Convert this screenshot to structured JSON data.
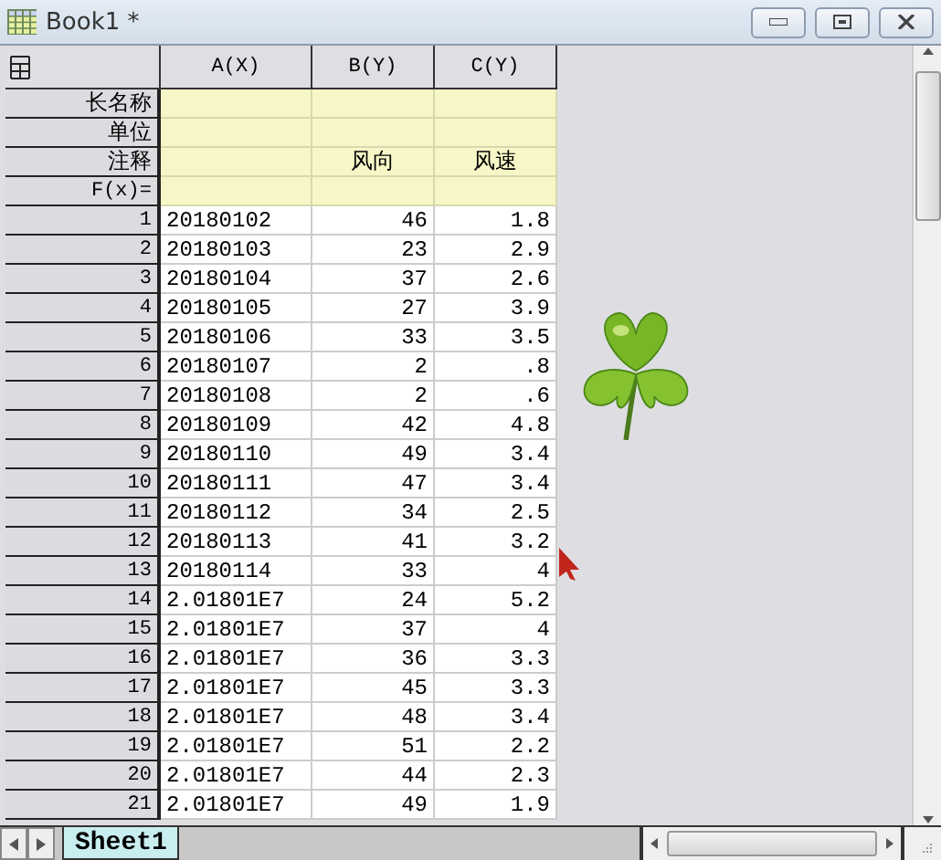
{
  "window": {
    "title": "Book1 *"
  },
  "columns": [
    {
      "label": "A(X)"
    },
    {
      "label": "B(Y)"
    },
    {
      "label": "C(Y)"
    }
  ],
  "label_rows": [
    {
      "label": "长名称",
      "cells": {}
    },
    {
      "label": "单位",
      "cells": {}
    },
    {
      "label": "注释",
      "cells": {
        "b": "风向",
        "c": "风速"
      }
    },
    {
      "label": "F(x)=",
      "cells": {}
    }
  ],
  "rows": [
    {
      "number": "1",
      "cells": [
        "20180102",
        "46",
        "1.8"
      ]
    },
    {
      "number": "2",
      "cells": [
        "20180103",
        "23",
        "2.9"
      ]
    },
    {
      "number": "3",
      "cells": [
        "20180104",
        "37",
        "2.6"
      ]
    },
    {
      "number": "4",
      "cells": [
        "20180105",
        "27",
        "3.9"
      ]
    },
    {
      "number": "5",
      "cells": [
        "20180106",
        "33",
        "3.5"
      ]
    },
    {
      "number": "6",
      "cells": [
        "20180107",
        "2",
        ".8"
      ]
    },
    {
      "number": "7",
      "cells": [
        "20180108",
        "2",
        ".6"
      ]
    },
    {
      "number": "8",
      "cells": [
        "20180109",
        "42",
        "4.8"
      ]
    },
    {
      "number": "9",
      "cells": [
        "20180110",
        "49",
        "3.4"
      ]
    },
    {
      "number": "10",
      "cells": [
        "20180111",
        "47",
        "3.4"
      ]
    },
    {
      "number": "11",
      "cells": [
        "20180112",
        "34",
        "2.5"
      ]
    },
    {
      "number": "12",
      "cells": [
        "20180113",
        "41",
        "3.2"
      ]
    },
    {
      "number": "13",
      "cells": [
        "20180114",
        "33",
        "4"
      ]
    },
    {
      "number": "14",
      "cells": [
        "2.01801E7",
        "24",
        "5.2"
      ]
    },
    {
      "number": "15",
      "cells": [
        "2.01801E7",
        "37",
        "4"
      ]
    },
    {
      "number": "16",
      "cells": [
        "2.01801E7",
        "36",
        "3.3"
      ]
    },
    {
      "number": "17",
      "cells": [
        "2.01801E7",
        "45",
        "3.3"
      ]
    },
    {
      "number": "18",
      "cells": [
        "2.01801E7",
        "48",
        "3.4"
      ]
    },
    {
      "number": "19",
      "cells": [
        "2.01801E7",
        "51",
        "2.2"
      ]
    },
    {
      "number": "20",
      "cells": [
        "2.01801E7",
        "44",
        "2.3"
      ]
    },
    {
      "number": "21",
      "cells": [
        "2.01801E7",
        "49",
        "1.9"
      ]
    }
  ],
  "sheet_tabs": [
    {
      "label": "Sheet1",
      "selected": true
    }
  ]
}
